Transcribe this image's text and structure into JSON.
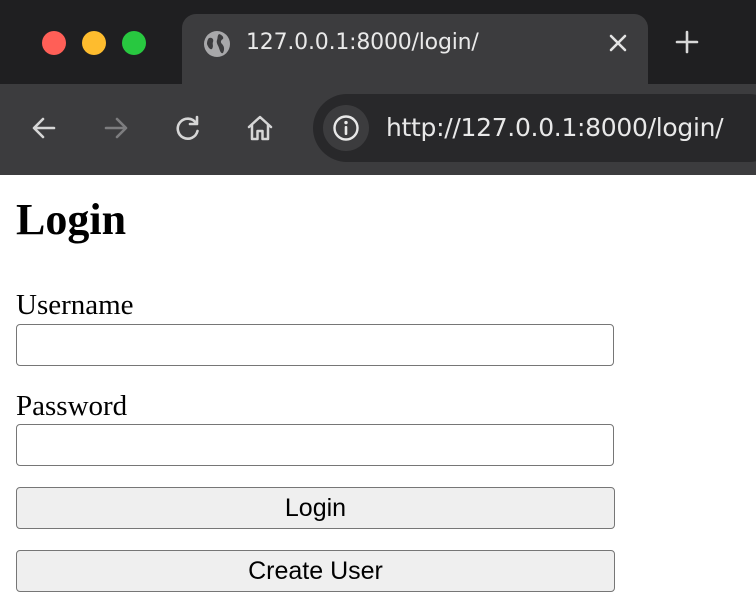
{
  "browser": {
    "tab": {
      "title": "127.0.0.1:8000/login/"
    },
    "address_bar": {
      "url": "http://127.0.0.1:8000/login/"
    }
  },
  "page": {
    "title": "Login",
    "username": {
      "label": "Username",
      "value": ""
    },
    "password": {
      "label": "Password",
      "value": ""
    },
    "buttons": {
      "login": "Login",
      "create_user": "Create User"
    }
  },
  "colors": {
    "close": "#ff5f57",
    "minimize": "#febc2e",
    "zoom": "#28c840",
    "chrome_dark": "#1f1f21",
    "chrome_toolbar": "#3c3c3e",
    "button_bg": "#efefef"
  },
  "icons": [
    "globe-icon",
    "close-icon",
    "plus-icon",
    "back-arrow-icon",
    "forward-arrow-icon",
    "reload-icon",
    "home-icon",
    "info-icon"
  ]
}
